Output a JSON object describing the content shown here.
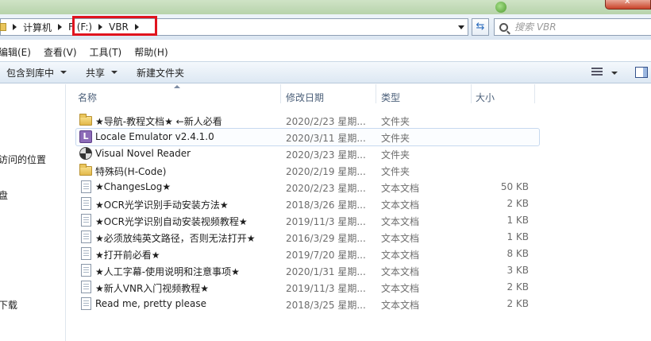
{
  "address_bar": {
    "crumbs": [
      "计算机",
      "F (F:)",
      "VBR"
    ]
  },
  "search": {
    "placeholder": "搜索 VBR"
  },
  "menu": {
    "items": [
      "编辑(E)",
      "查看(V)",
      "工具(T)",
      "帮助(H)"
    ]
  },
  "toolbar": {
    "include_library": "包含到库中",
    "share": "共享",
    "new_folder": "新建文件夹"
  },
  "nav": {
    "items": [
      "访问的位置",
      "盘",
      "下载"
    ]
  },
  "columns": {
    "name": "名称",
    "date": "修改日期",
    "type": "类型",
    "size": "大小"
  },
  "files": [
    {
      "name": "★导航-教程文档★ ←新人必看",
      "date": "2020/2/23 星期...",
      "type": "文件夹",
      "size": "",
      "icon": "folder-icon"
    },
    {
      "name": "Locale Emulator v2.4.1.0",
      "date": "2020/3/11 星期...",
      "type": "文件夹",
      "size": "",
      "icon": "locale-emulator-icon"
    },
    {
      "name": "Visual Novel Reader",
      "date": "2020/3/23 星期...",
      "type": "文件夹",
      "size": "",
      "icon": "vnr-icon"
    },
    {
      "name": "特殊码(H-Code)",
      "date": "2020/2/19 星期...",
      "type": "文件夹",
      "size": "",
      "icon": "folder-icon"
    },
    {
      "name": "★ChangesLog★",
      "date": "2020/2/23 星期...",
      "type": "文本文档",
      "size": "50 KB",
      "icon": "text-file-icon"
    },
    {
      "name": "★OCR光学识别手动安装方法★",
      "date": "2018/3/26 星期...",
      "type": "文本文档",
      "size": "2 KB",
      "icon": "text-file-icon"
    },
    {
      "name": "★OCR光学识别自动安装视频教程★",
      "date": "2019/11/3 星期...",
      "type": "文本文档",
      "size": "1 KB",
      "icon": "text-file-icon"
    },
    {
      "name": "★必须放纯英文路径，否则无法打开★",
      "date": "2016/3/29 星期...",
      "type": "文本文档",
      "size": "1 KB",
      "icon": "text-file-icon"
    },
    {
      "name": "★打开前必看★",
      "date": "2019/7/20 星期...",
      "type": "文本文档",
      "size": "8 KB",
      "icon": "text-file-icon"
    },
    {
      "name": "★人工字幕-使用说明和注意事项★",
      "date": "2020/1/31 星期...",
      "type": "文本文档",
      "size": "3 KB",
      "icon": "text-file-icon"
    },
    {
      "name": "★新人VNR入门视频教程★",
      "date": "2019/11/3 星期...",
      "type": "文本文档",
      "size": "2 KB",
      "icon": "text-file-icon"
    },
    {
      "name": "Read me, pretty please",
      "date": "2018/3/25 星期...",
      "type": "文本文档",
      "size": "2 KB",
      "icon": "text-file-icon"
    }
  ],
  "colors": {
    "highlight_box": "#e0141e",
    "toolbar_bg": "#dde8f3",
    "header_text": "#4c607a"
  }
}
